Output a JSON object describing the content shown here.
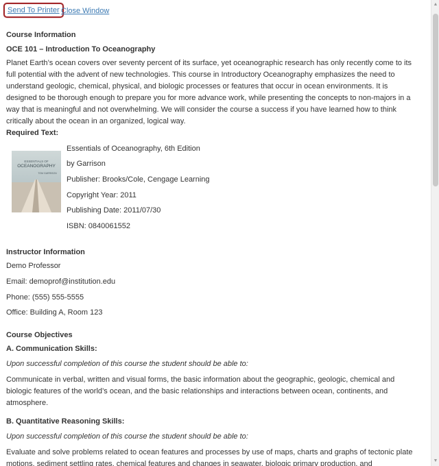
{
  "toolbar": {
    "print_label": "Send To Printer",
    "close_label": "Close Window"
  },
  "course_info": {
    "heading": "Course Information",
    "title": "OCE 101 – Introduction To Oceanography",
    "description": "Planet Earth’s ocean covers over seventy percent of its surface, yet oceanographic research has only recently come to its full potential with the advent of new technologies. This course in Introductory Oceanography emphasizes the need to understand geologic, chemical, physical, and biologic processes or features that occur in ocean environments. It is designed to be thorough enough to prepare you for more advance work, while presenting the concepts to non-majors in a way that is meaningful and not overwhelming. We will consider the course a success if you have learned how to think critically about the ocean in an organized, logical way."
  },
  "required_text": {
    "heading": "Required Text:",
    "cover_title": "ESSENTIALS OF OCEANOGRAPHY",
    "cover_author": "TOM GARRISON",
    "title": "Essentials of Oceanography, 6th Edition",
    "author": "by Garrison",
    "publisher": "Publisher: Brooks/Cole, Cengage Learning",
    "copyright": "Copyright Year: 2011",
    "pub_date": "Publishing Date: 2011/07/30",
    "isbn": "ISBN: 0840061552"
  },
  "instructor": {
    "heading": "Instructor Information",
    "name": "Demo Professor",
    "email": "Email: demoprof@institution.edu",
    "phone": "Phone: (555) 555-5555",
    "office": "Office: Building A, Room 123"
  },
  "objectives": {
    "heading": "Course Objectives",
    "a_heading": "A. Communication Skills:",
    "a_intro": "Upon successful completion of this course the student should be able to:",
    "a_text": "Communicate in verbal, written and visual forms, the basic information about the geographic, geologic, chemical and biologic features of the world’s ocean, and the basic relationships and interactions between ocean, continents, and atmosphere.",
    "b_heading": "B.  Quantitative Reasoning Skills:",
    "b_intro": "Upon successful completion of this course the student should be able to:",
    "b_text": "Evaluate and solve problems related to ocean features and processes by use of maps, charts and graphs of tectonic plate motions, sediment settling rates, chemical features and changes in seawater, biologic primary production, and characteristics of oceanic life."
  }
}
